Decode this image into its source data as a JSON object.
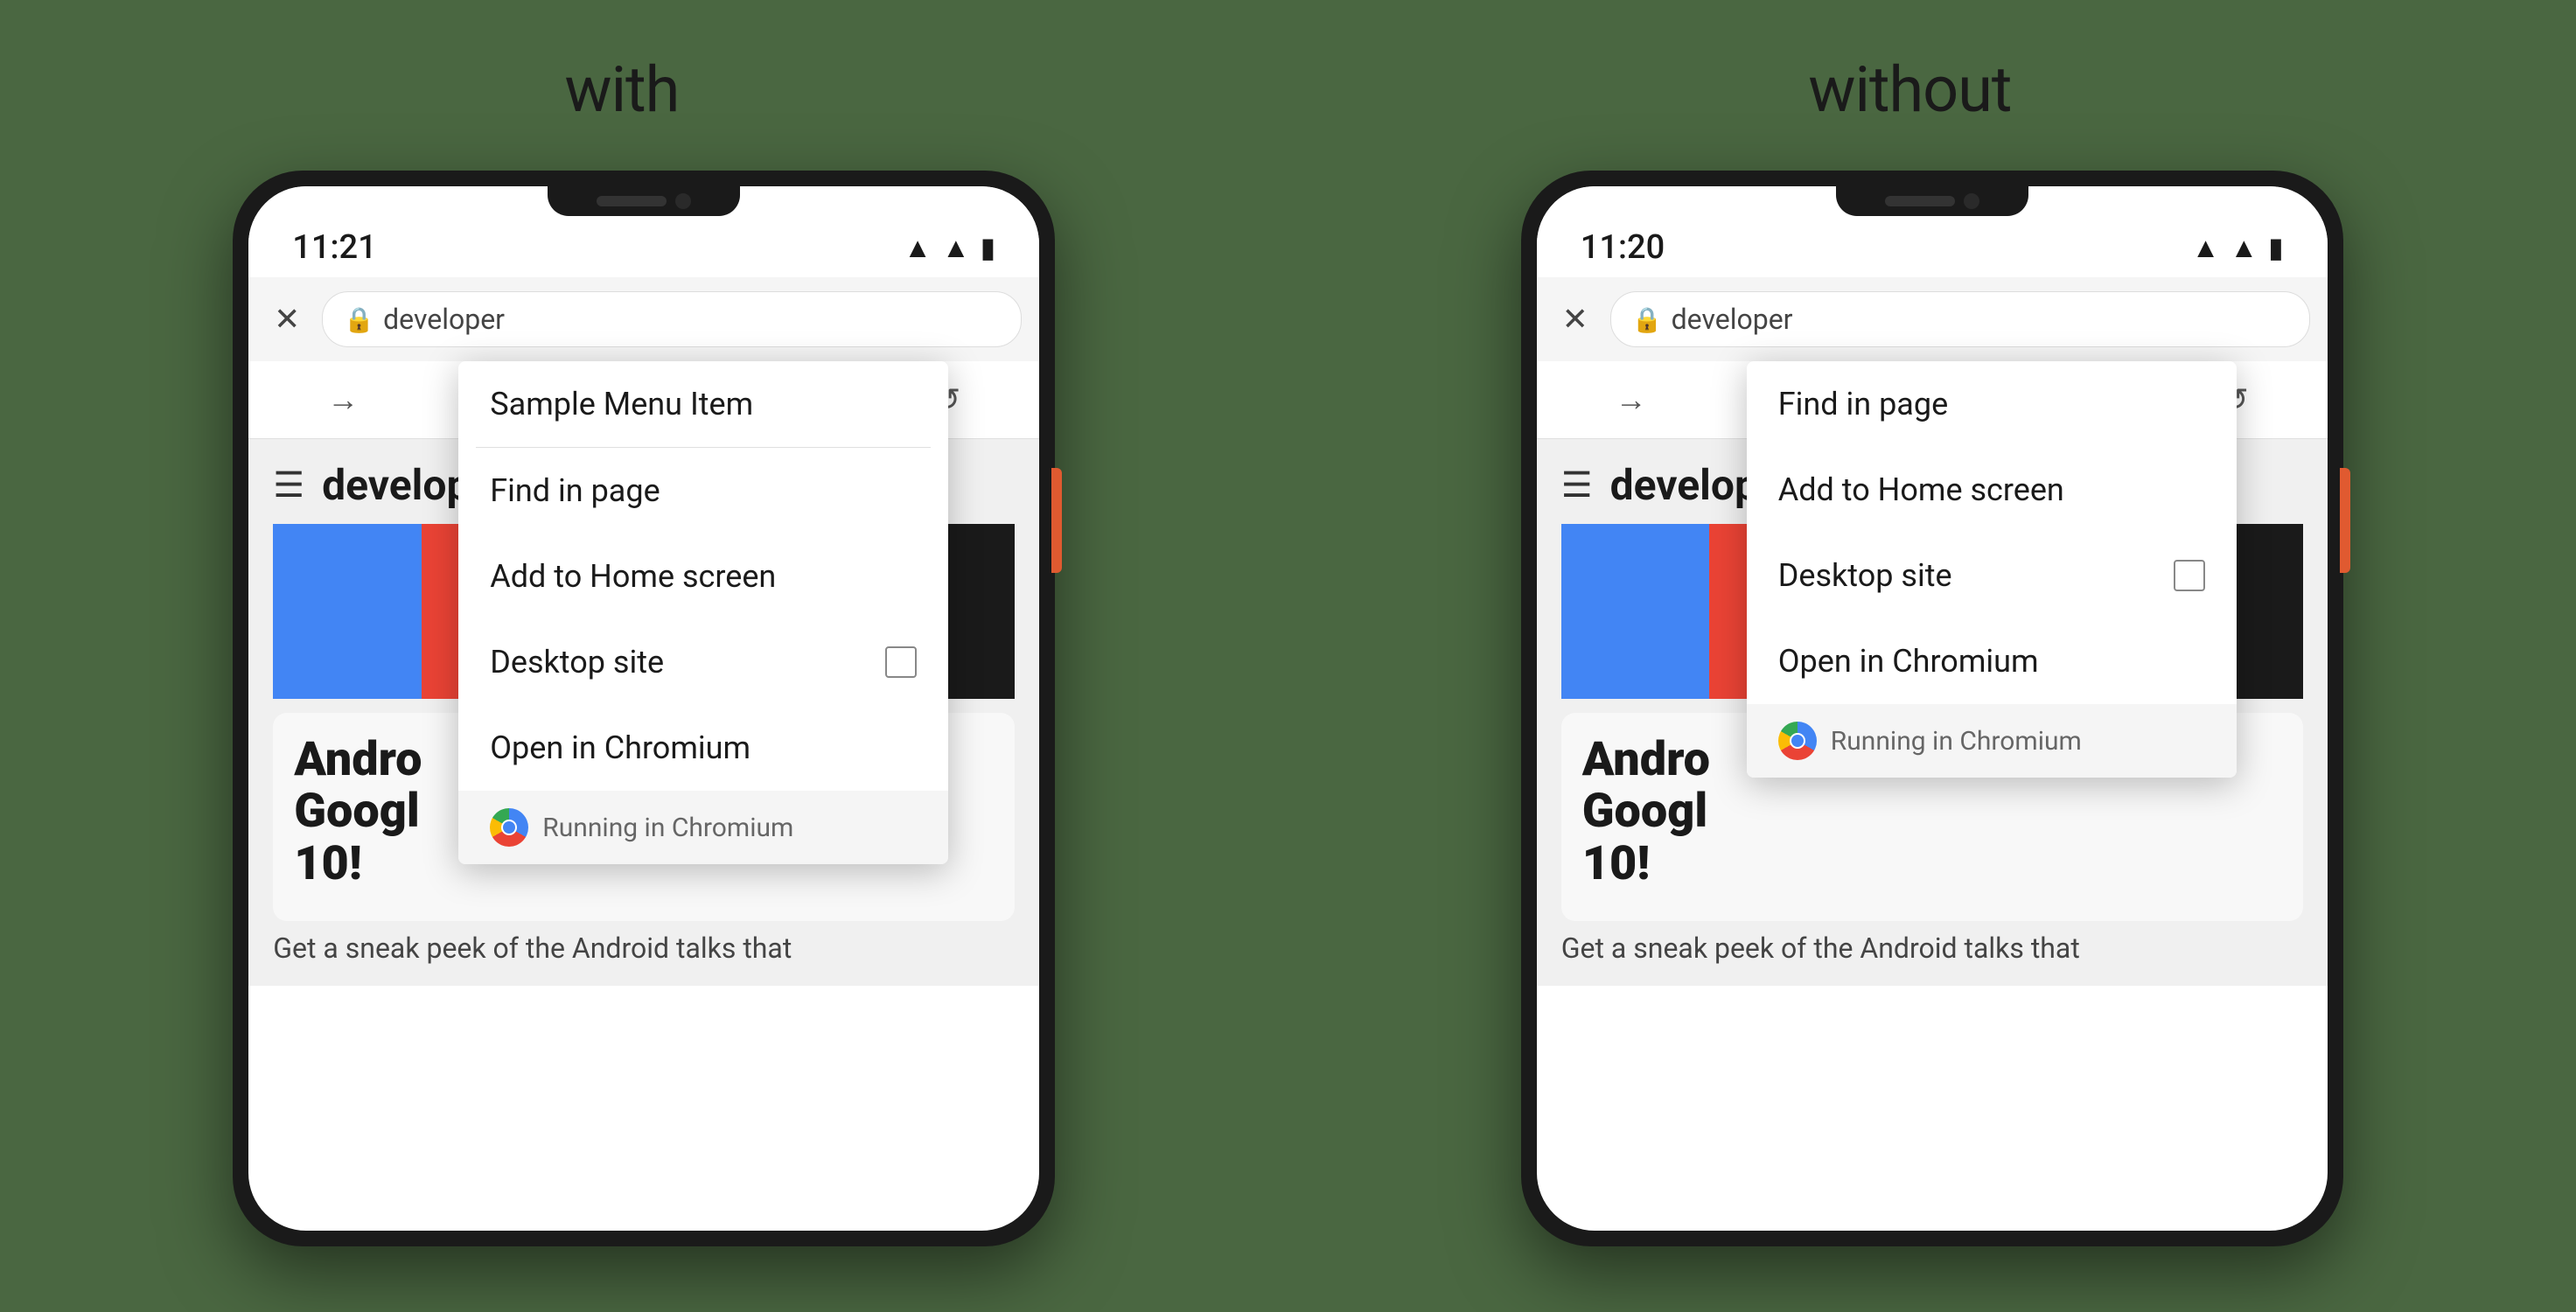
{
  "background_color": "#4a6741",
  "left_panel": {
    "label": "with",
    "phone": {
      "time": "11:21",
      "url": "developer",
      "page_title": "develop",
      "hero_title": "Andro\nGoogl\n10!",
      "hero_subtitle": "Get a sneak peek of the Android talks that",
      "color_bars": [
        "#4285f4",
        "#ea4335",
        "#fbbc05",
        "#34a853",
        "#1a1a1a"
      ],
      "context_menu": {
        "items": [
          {
            "label": "Sample Menu Item",
            "has_checkbox": false
          },
          {
            "label": "Find in page",
            "has_checkbox": false
          },
          {
            "label": "Add to Home screen",
            "has_checkbox": false
          },
          {
            "label": "Desktop site",
            "has_checkbox": true
          },
          {
            "label": "Open in Chromium",
            "has_checkbox": false
          }
        ],
        "footer_text": "Running in Chromium"
      },
      "toolbar_icons": [
        "→",
        "☆",
        "⬇",
        "ⓘ",
        "↺"
      ]
    }
  },
  "right_panel": {
    "label": "without",
    "phone": {
      "time": "11:20",
      "url": "developer",
      "page_title": "develop",
      "hero_title": "Andro\nGoogl\n10!",
      "hero_subtitle": "Get a sneak peek of the Android talks that",
      "color_bars": [
        "#4285f4",
        "#ea4335",
        "#fbbc05",
        "#34a853",
        "#1a1a1a"
      ],
      "context_menu": {
        "items": [
          {
            "label": "Find in page",
            "has_checkbox": false
          },
          {
            "label": "Add to Home screen",
            "has_checkbox": false
          },
          {
            "label": "Desktop site",
            "has_checkbox": true
          },
          {
            "label": "Open in Chromium",
            "has_checkbox": false
          }
        ],
        "footer_text": "Running in Chromium"
      },
      "toolbar_icons": [
        "→",
        "☆",
        "⬇",
        "ⓘ",
        "↺"
      ]
    }
  }
}
